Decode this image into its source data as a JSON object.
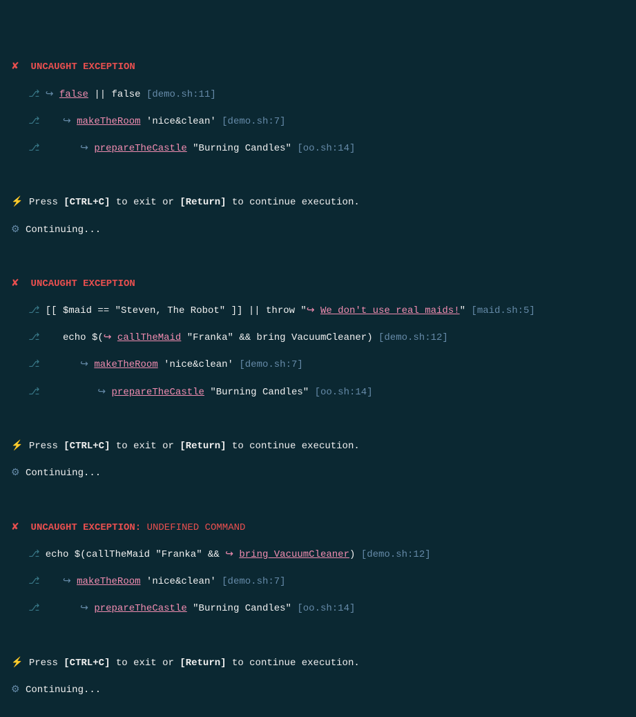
{
  "icons": {
    "x": "✘",
    "bolt": "⚡",
    "gear": "⚙",
    "branch": "⎇",
    "arrow": "↪"
  },
  "exc1": {
    "title": "UNCAUGHT EXCEPTION",
    "l1": {
      "cmd": "false",
      "rest": " || false ",
      "loc": "[demo.sh:11]"
    },
    "l2": {
      "cmd": "makeTheRoom",
      "arg": " 'nice&clean' ",
      "loc": "[demo.sh:7]"
    },
    "l3": {
      "cmd": "prepareTheCastle",
      "arg": " \"Burning Candles\" ",
      "loc": "[oo.sh:14]"
    }
  },
  "prompt": {
    "p1": "Press ",
    "k1": "[CTRL+C]",
    "p2": " to exit or ",
    "k2": "[Return]",
    "p3": " to continue execution."
  },
  "continuing": "Continuing...",
  "exc2": {
    "title": "UNCAUGHT EXCEPTION",
    "l1": {
      "pre": "[[ $maid == \"Steven, The Robot\" ]] || throw \"",
      "msg": "We don't use real maids!",
      "post": "\" ",
      "loc": "[maid.sh:5]"
    },
    "l2": {
      "pre": "echo $(",
      "cmd": "callTheMaid",
      "mid": " \"Franka\" && bring VacuumCleaner) ",
      "loc": "[demo.sh:12]"
    },
    "l3": {
      "cmd": "makeTheRoom",
      "arg": " 'nice&clean' ",
      "loc": "[demo.sh:7]"
    },
    "l4": {
      "cmd": "prepareTheCastle",
      "arg": " \"Burning Candles\" ",
      "loc": "[oo.sh:14]"
    }
  },
  "exc3": {
    "title": "UNCAUGHT EXCEPTION:",
    "sub": " UNDEFINED COMMAND",
    "l1": {
      "pre": "echo $(callTheMaid \"Franka\" && ",
      "cmd": "bring VacuumCleaner",
      "post": ") ",
      "loc": "[demo.sh:12]"
    },
    "l2": {
      "cmd": "makeTheRoom",
      "arg": " 'nice&clean' ",
      "loc": "[demo.sh:7]"
    },
    "l3": {
      "cmd": "prepareTheCastle",
      "arg": " \"Burning Candles\" ",
      "loc": "[oo.sh:14]"
    }
  }
}
